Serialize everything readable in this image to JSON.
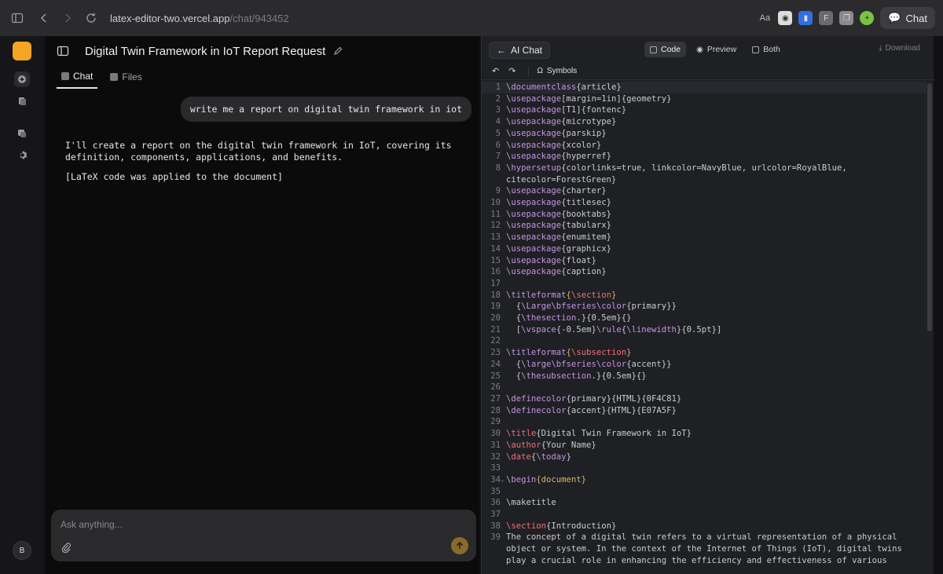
{
  "browser": {
    "url_host": "latex-editor-two.vercel.app",
    "url_path": "/chat/943452",
    "chat_button": "Chat"
  },
  "rail": {
    "avatar_initial": "B"
  },
  "chat": {
    "title": "Digital Twin Framework in IoT Report Request",
    "tabs": [
      {
        "label": "Chat"
      },
      {
        "label": "Files"
      }
    ],
    "user_message": "write me a report on digital twin framework in iot",
    "assistant_message": "I'll create a report on the digital twin framework in IoT, covering its\ndefinition, components, applications, and benefits.",
    "assistant_note": "[LaTeX code was applied to the document]",
    "composer_placeholder": "Ask anything..."
  },
  "editor": {
    "ai_chat_label": "AI Chat",
    "view_tabs": [
      {
        "label": "Code"
      },
      {
        "label": "Preview"
      },
      {
        "label": "Both"
      }
    ],
    "download_label": "Download",
    "symbols_label": "Symbols",
    "lines": [
      {
        "n": "1",
        "t": [
          [
            "c",
            "\\documentclass"
          ],
          [
            "p",
            "{article}"
          ]
        ]
      },
      {
        "n": "2",
        "t": [
          [
            "c",
            "\\usepackage"
          ],
          [
            "p",
            "[margin=1in]{geometry}"
          ]
        ]
      },
      {
        "n": "3",
        "t": [
          [
            "c",
            "\\usepackage"
          ],
          [
            "p",
            "[T1]{fontenc}"
          ]
        ]
      },
      {
        "n": "4",
        "t": [
          [
            "c",
            "\\usepackage"
          ],
          [
            "p",
            "{microtype}"
          ]
        ]
      },
      {
        "n": "5",
        "t": [
          [
            "c",
            "\\usepackage"
          ],
          [
            "p",
            "{parskip}"
          ]
        ]
      },
      {
        "n": "6",
        "t": [
          [
            "c",
            "\\usepackage"
          ],
          [
            "p",
            "{xcolor}"
          ]
        ]
      },
      {
        "n": "7",
        "t": [
          [
            "c",
            "\\usepackage"
          ],
          [
            "p",
            "{hyperref}"
          ]
        ]
      },
      {
        "n": "8",
        "t": [
          [
            "c",
            "\\hypersetup"
          ],
          [
            "p",
            "{colorlinks=true, linkcolor=NavyBlue, urlcolor=RoyalBlue,\ncitecolor=ForestGreen}"
          ]
        ]
      },
      {
        "n": "9",
        "t": [
          [
            "c",
            "\\usepackage"
          ],
          [
            "p",
            "{charter}"
          ]
        ]
      },
      {
        "n": "10",
        "t": [
          [
            "c",
            "\\usepackage"
          ],
          [
            "p",
            "{titlesec}"
          ]
        ]
      },
      {
        "n": "11",
        "t": [
          [
            "c",
            "\\usepackage"
          ],
          [
            "p",
            "{booktabs}"
          ]
        ]
      },
      {
        "n": "12",
        "t": [
          [
            "c",
            "\\usepackage"
          ],
          [
            "p",
            "{tabularx}"
          ]
        ]
      },
      {
        "n": "13",
        "t": [
          [
            "c",
            "\\usepackage"
          ],
          [
            "p",
            "{enumitem}"
          ]
        ]
      },
      {
        "n": "14",
        "t": [
          [
            "c",
            "\\usepackage"
          ],
          [
            "p",
            "{graphicx}"
          ]
        ]
      },
      {
        "n": "15",
        "t": [
          [
            "c",
            "\\usepackage"
          ],
          [
            "p",
            "{float}"
          ]
        ]
      },
      {
        "n": "16",
        "t": [
          [
            "c",
            "\\usepackage"
          ],
          [
            "p",
            "{caption}"
          ]
        ]
      },
      {
        "n": "17",
        "t": []
      },
      {
        "n": "18",
        "t": [
          [
            "c",
            "\\titleformat"
          ],
          [
            "a",
            "{"
          ],
          [
            "f",
            "\\section"
          ],
          [
            "a",
            "}"
          ]
        ]
      },
      {
        "n": "19",
        "t": [
          [
            "p",
            "  {"
          ],
          [
            "c",
            "\\Large\\bfseries\\color"
          ],
          [
            "p",
            "{primary}}"
          ]
        ]
      },
      {
        "n": "20",
        "t": [
          [
            "p",
            "  {"
          ],
          [
            "c",
            "\\thesection"
          ],
          [
            "p",
            ".}{0.5em}{}"
          ]
        ]
      },
      {
        "n": "21",
        "t": [
          [
            "p",
            "  ["
          ],
          [
            "c",
            "\\vspace"
          ],
          [
            "p",
            "{-0.5em}"
          ],
          [
            "c",
            "\\rule"
          ],
          [
            "p",
            "{"
          ],
          [
            "c",
            "\\linewidth"
          ],
          [
            "p",
            "}{0.5pt}]"
          ]
        ]
      },
      {
        "n": "22",
        "t": []
      },
      {
        "n": "23",
        "t": [
          [
            "c",
            "\\titleformat"
          ],
          [
            "a",
            "{"
          ],
          [
            "f",
            "\\subsection"
          ],
          [
            "a",
            "}"
          ]
        ]
      },
      {
        "n": "24",
        "t": [
          [
            "p",
            "  {"
          ],
          [
            "c",
            "\\large\\bfseries\\color"
          ],
          [
            "p",
            "{accent}}"
          ]
        ]
      },
      {
        "n": "25",
        "t": [
          [
            "p",
            "  {"
          ],
          [
            "c",
            "\\thesubsection"
          ],
          [
            "p",
            ".}{0.5em}{}"
          ]
        ]
      },
      {
        "n": "26",
        "t": []
      },
      {
        "n": "27",
        "t": [
          [
            "c",
            "\\definecolor"
          ],
          [
            "p",
            "{primary}{HTML}{0F4C81}"
          ]
        ]
      },
      {
        "n": "28",
        "t": [
          [
            "c",
            "\\definecolor"
          ],
          [
            "p",
            "{accent}{HTML}{E07A5F}"
          ]
        ]
      },
      {
        "n": "29",
        "t": []
      },
      {
        "n": "30",
        "t": [
          [
            "f",
            "\\title"
          ],
          [
            "p",
            "{Digital Twin Framework in IoT}"
          ]
        ]
      },
      {
        "n": "31",
        "t": [
          [
            "f",
            "\\author"
          ],
          [
            "p",
            "{Your Name}"
          ]
        ]
      },
      {
        "n": "32",
        "t": [
          [
            "f",
            "\\date"
          ],
          [
            "p",
            "{"
          ],
          [
            "c",
            "\\today"
          ],
          [
            "p",
            "}"
          ]
        ]
      },
      {
        "n": "33",
        "t": []
      },
      {
        "n": "34",
        "fold": true,
        "t": [
          [
            "c",
            "\\begin"
          ],
          [
            "a",
            "{document}"
          ]
        ]
      },
      {
        "n": "35",
        "t": []
      },
      {
        "n": "36",
        "t": [
          [
            "p",
            "\\maketitle"
          ]
        ]
      },
      {
        "n": "37",
        "t": []
      },
      {
        "n": "38",
        "t": [
          [
            "f",
            "\\section"
          ],
          [
            "p",
            "{Introduction}"
          ]
        ]
      },
      {
        "n": "39",
        "t": [
          [
            "p",
            "The concept of a digital twin refers to a virtual representation of a physical\nobject or system. In the context of the Internet of Things (IoT), digital twins\nplay a crucial role in enhancing the efficiency and effectiveness of various"
          ]
        ]
      }
    ]
  }
}
